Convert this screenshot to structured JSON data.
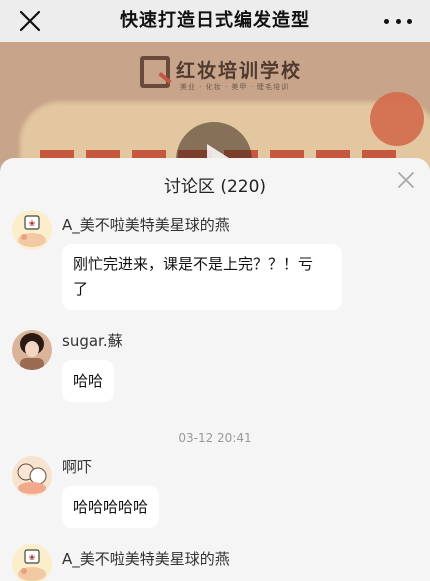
{
  "header": {
    "title": "快速打造日式编发造型"
  },
  "banner": {
    "brand": "红妆培训学校",
    "slogan": "美业 · 化妆 · 美甲 · 睫毛培训"
  },
  "discussion": {
    "title": "讨论区 (220)",
    "messages": [
      {
        "sender": "A_美不啦美特美星球的燕",
        "text_line1": "刚忙完进来，课是不是上完？？！亏",
        "text_line2": "了"
      },
      {
        "sender": "sugar.蘇",
        "text": "哈哈"
      },
      {
        "timestamp": "03-12 20:41"
      },
      {
        "sender": "啊吓",
        "text": "哈哈哈哈哈"
      },
      {
        "sender": "A_美不啦美特美星球的燕"
      }
    ]
  },
  "colors": {
    "sheet_bg": "#f5f5f5",
    "bubble_bg": "#ffffff",
    "nav_bg": "#ededed"
  }
}
